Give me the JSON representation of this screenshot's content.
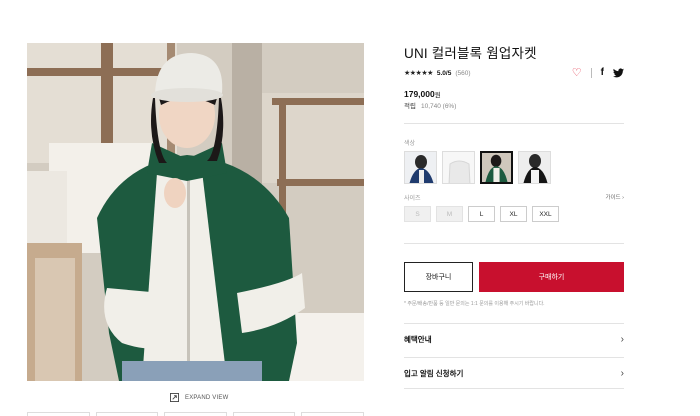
{
  "product": {
    "title": "UNI 컬러블록 웜업자켓",
    "stars": "★★★★★",
    "score": "5.0/5",
    "reviews": "(560)",
    "price_value": "179,000",
    "price_unit": "원",
    "points_label": "적립",
    "points_value": "10,740 (6%)"
  },
  "icons": {
    "heart": "heart-icon",
    "facebook": "facebook-icon",
    "twitter": "twitter-icon",
    "expand": "expand-icon",
    "chevron": "chevron-right-icon"
  },
  "colors_label": "색상",
  "size_label": "사이즈",
  "size_guide": "가이드",
  "sizes": [
    {
      "label": "S",
      "available": false
    },
    {
      "label": "M",
      "available": false
    },
    {
      "label": "L",
      "available": true
    },
    {
      "label": "XL",
      "available": true
    },
    {
      "label": "XXL",
      "available": true
    }
  ],
  "buttons": {
    "cart": "장바구니",
    "buy": "구매하기"
  },
  "notice": "* 주문/배송/반품 등 일반 문의는 1:1 문의를 이용해 주시기 바랍니다.",
  "info_rows": [
    "혜택안내",
    "입고 알림 신청하기"
  ],
  "expand_view": "EXPAND VIEW",
  "accent": "#c8102e"
}
